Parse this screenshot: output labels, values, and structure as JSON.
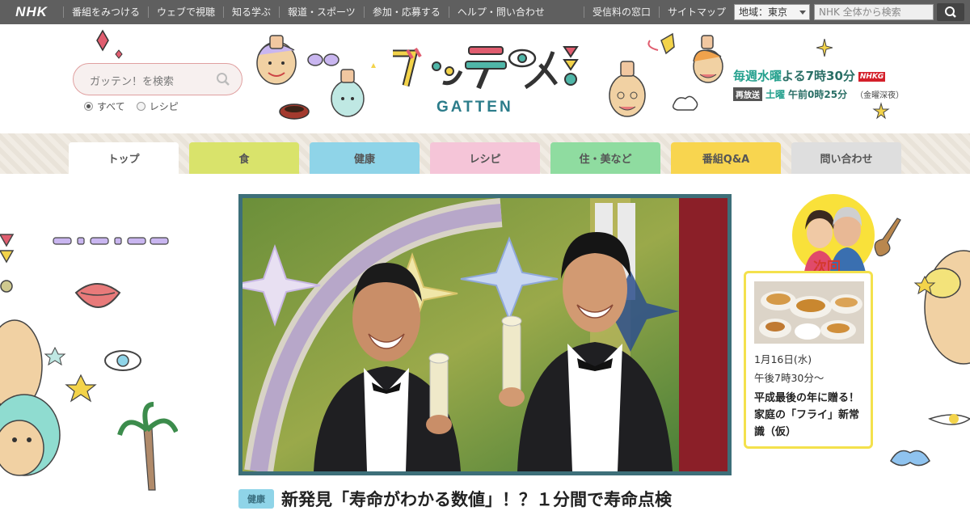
{
  "global_nav": {
    "logo": "NHK",
    "items": [
      "番組をみつける",
      "ウェブで視聴",
      "知る学ぶ",
      "報道・スポーツ",
      "参加・応募する",
      "ヘルプ・問い合わせ"
    ],
    "right_items": [
      "受信料の窓口",
      "サイトマップ"
    ],
    "region_label": "地域：東京",
    "search_placeholder": "NHK 全体から検索"
  },
  "site_search": {
    "placeholder": "ガッテン！を検索",
    "options": [
      "すべて",
      "レシピ"
    ],
    "selected": "すべて"
  },
  "logo": {
    "ja": "ガッテン!",
    "en": "GATTEN"
  },
  "broadcast": {
    "day": "毎週水曜",
    "time": "よる7時30分",
    "channel_badge": "NHKG",
    "rerun_badge": "再放送",
    "rerun_day": "土曜",
    "rerun_time": "午前0時25分",
    "rerun_note": "（金曜深夜）"
  },
  "tabs": [
    {
      "label": "トップ",
      "color": "#ffffff",
      "active": true
    },
    {
      "label": "食",
      "color": "#d9e36b",
      "active": false
    },
    {
      "label": "健康",
      "color": "#8fd4e8",
      "active": false
    },
    {
      "label": "レシピ",
      "color": "#f5c5d8",
      "active": false
    },
    {
      "label": "住・美など",
      "color": "#8fdca0",
      "active": false
    },
    {
      "label": "番組Q&A",
      "color": "#f8d54f",
      "active": false
    },
    {
      "label": "問い合わせ",
      "color": "#dedede",
      "active": false
    }
  ],
  "feature": {
    "category": "健康",
    "title": "新発見「寿命がわかる数値」！？１分間で寿命点検"
  },
  "next_episode": {
    "badge": "次回",
    "date": "1月16日(水)",
    "time": "午後7時30分〜",
    "title": "平成最後の年に贈る！家庭の「フライ」新常識（仮）"
  },
  "colors": {
    "topbar": "#5f5f5f",
    "accent_teal": "#23a08d",
    "next_border": "#f4e14c",
    "frame": "#3d6f79"
  }
}
